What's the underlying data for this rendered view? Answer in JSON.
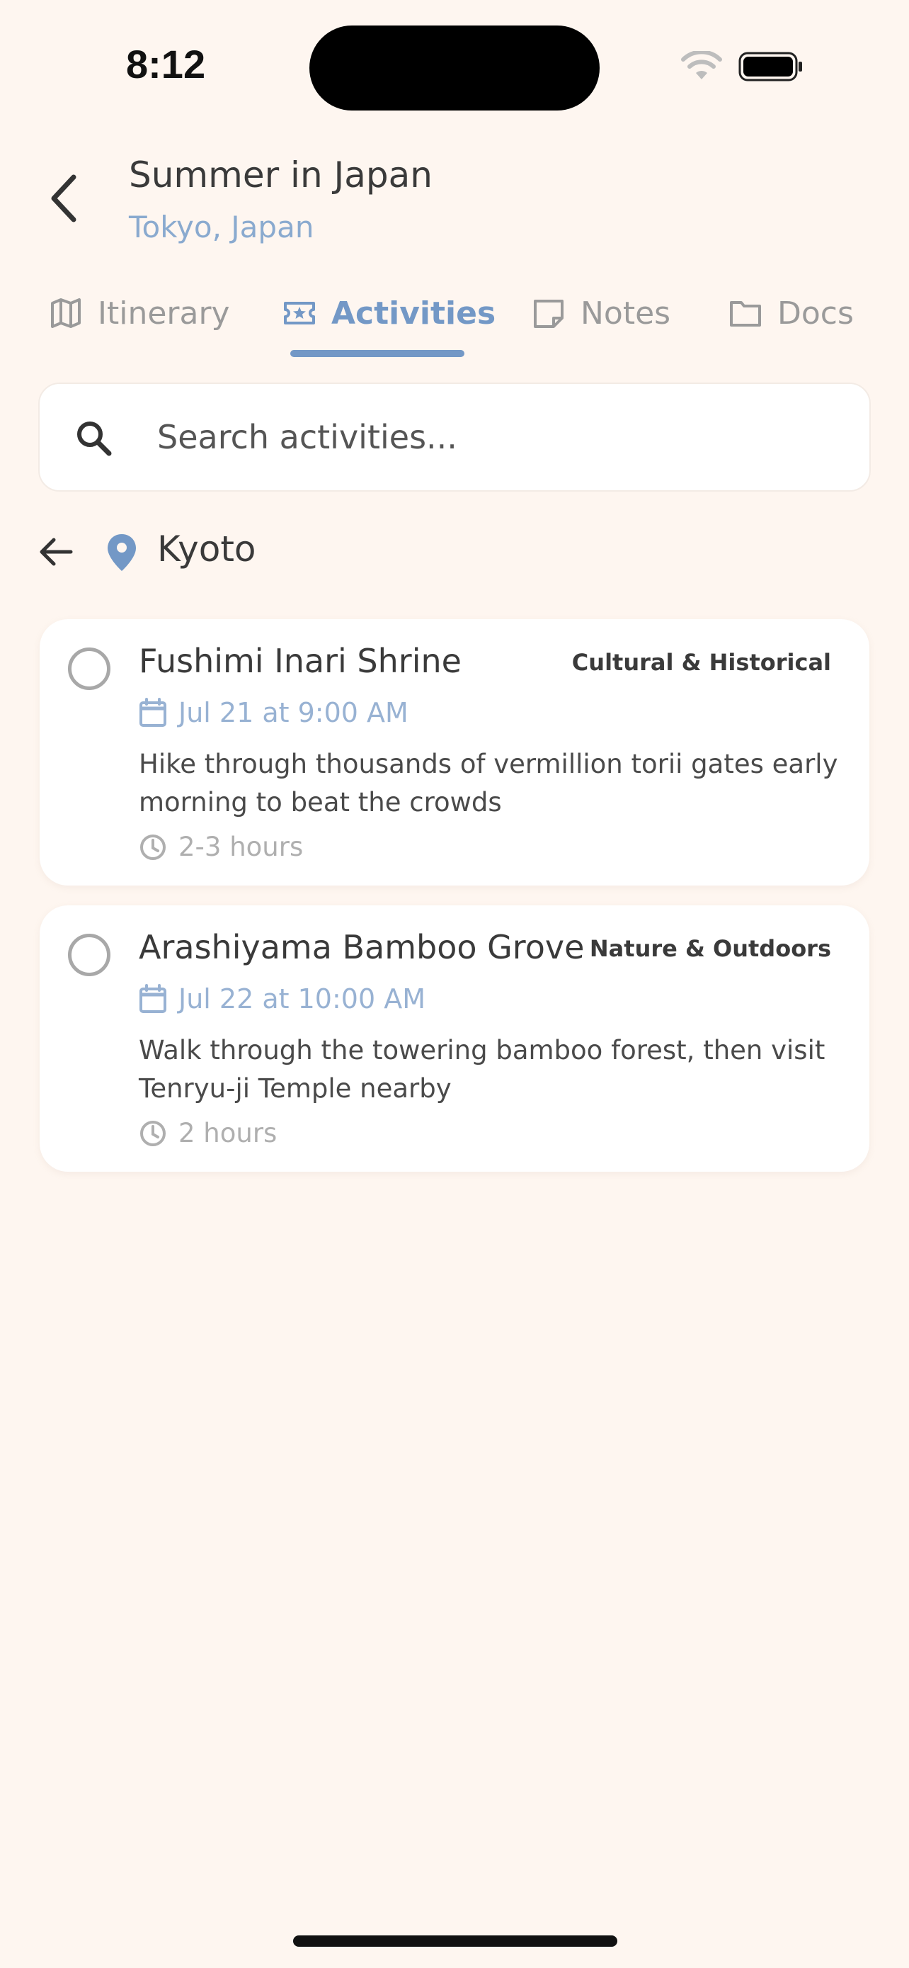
{
  "status_bar": {
    "time": "8:12"
  },
  "header": {
    "title": "Summer in Japan",
    "location": "Tokyo, Japan"
  },
  "tabs": [
    {
      "label": "Itinerary",
      "icon": "map-icon",
      "active": false
    },
    {
      "label": "Activities",
      "icon": "ticket-star-icon",
      "active": true
    },
    {
      "label": "Notes",
      "icon": "note-icon",
      "active": false
    },
    {
      "label": "Docs",
      "icon": "folder-icon",
      "active": false
    }
  ],
  "search": {
    "placeholder": "Search activities..."
  },
  "location_filter": {
    "name": "Kyoto"
  },
  "activities": [
    {
      "title": "Fushimi Inari Shrine",
      "category": "Cultural & Historical",
      "date": "Jul 21 at 9:00 AM",
      "description": "Hike through thousands of vermillion torii gates early morning to beat the crowds",
      "duration": "2-3 hours",
      "completed": false
    },
    {
      "title": "Arashiyama Bamboo Grove",
      "category": "Nature & Outdoors",
      "date": "Jul 22 at 10:00 AM",
      "description": "Walk through the towering bamboo forest, then visit Tenryu-ji Temple nearby",
      "duration": "2 hours",
      "completed": false
    }
  ],
  "colors": {
    "background": "#FEF6F0",
    "accent": "#7398C6",
    "date_text": "#98B2D3",
    "muted": "#9A9A9A"
  }
}
